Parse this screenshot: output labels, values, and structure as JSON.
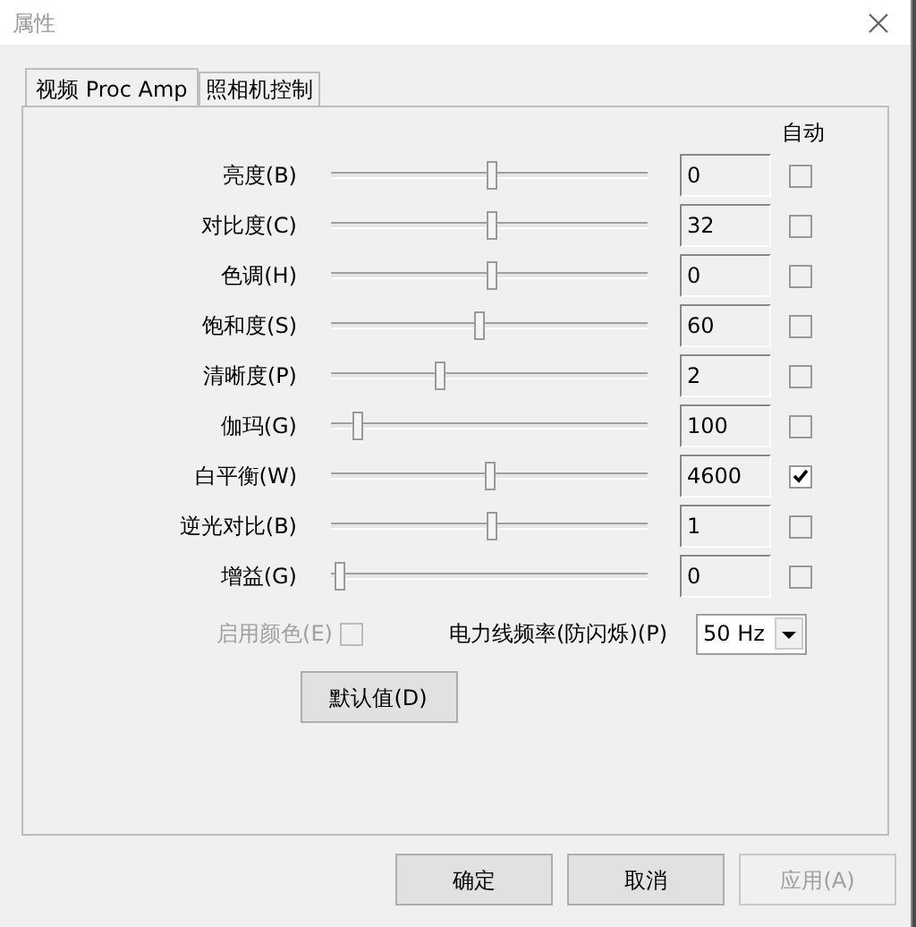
{
  "window": {
    "title": "属性"
  },
  "tabs": [
    {
      "label": "视频 Proc Amp",
      "selected": true
    },
    {
      "label": "照相机控制",
      "selected": false
    }
  ],
  "auto_heading": "自动",
  "controls": [
    {
      "label": "亮度(B)",
      "level": 0.51,
      "value": "0",
      "auto": false
    },
    {
      "label": "对比度(C)",
      "level": 0.51,
      "value": "32",
      "auto": false
    },
    {
      "label": "色调(H)",
      "level": 0.51,
      "value": "0",
      "auto": false
    },
    {
      "label": "饱和度(S)",
      "level": 0.47,
      "value": "60",
      "auto": false
    },
    {
      "label": "清晰度(P)",
      "level": 0.34,
      "value": "2",
      "auto": false
    },
    {
      "label": "伽玛(G)",
      "level": 0.07,
      "value": "100",
      "auto": false
    },
    {
      "label": "白平衡(W)",
      "level": 0.5,
      "value": "4600",
      "auto": true
    },
    {
      "label": "逆光对比(B)",
      "level": 0.51,
      "value": "1",
      "auto": false
    },
    {
      "label": "增益(G)",
      "level": 0.01,
      "value": "0",
      "auto": false
    }
  ],
  "enable_color": {
    "label": "启用颜色(E)",
    "checked": false,
    "disabled": true
  },
  "powerline": {
    "label": "电力线频率(防闪烁)(P)",
    "value": "50 Hz"
  },
  "default_button": "默认值(D)",
  "buttons": [
    {
      "label": "确定",
      "disabled": false
    },
    {
      "label": "取消",
      "disabled": false
    },
    {
      "label": "应用(A)",
      "disabled": true
    }
  ]
}
